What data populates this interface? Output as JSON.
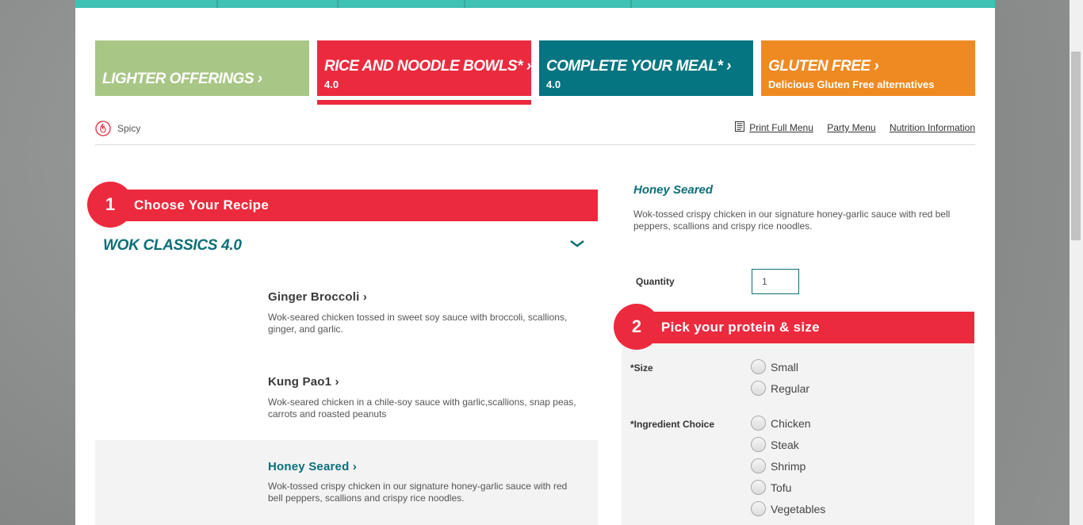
{
  "categories": [
    {
      "title": "LIGHTER OFFERINGS",
      "subtitle": ""
    },
    {
      "title": "RICE AND NOODLE BOWLS*",
      "subtitle": "4.0"
    },
    {
      "title": "COMPLETE YOUR MEAL*",
      "subtitle": "4.0"
    },
    {
      "title": "GLUTEN FREE",
      "subtitle": "Delicious Gluten Free alternatives"
    }
  ],
  "chevron": "›",
  "legend": {
    "spicy_label": "Spicy",
    "spicy_icon": "flame-icon"
  },
  "links": {
    "print": "Print Full Menu",
    "party": "Party Menu",
    "nutrition": "Nutrition Information"
  },
  "step1": {
    "number": "1",
    "label": "Choose Your Recipe"
  },
  "section": {
    "title": "WOK CLASSICS 4.0"
  },
  "recipes": [
    {
      "name": "Ginger Broccoli",
      "desc": "Wok-seared chicken tossed in sweet soy sauce with broccoli, scallions, ginger, and garlic."
    },
    {
      "name": "Kung Pao1",
      "desc": "Wok-seared chicken in a chile-soy sauce with garlic,scallions, snap peas, carrots and roasted peanuts"
    },
    {
      "name": "Honey Seared",
      "desc": "Wok-tossed crispy chicken in our signature honey-garlic sauce with red bell peppers, scallions and crispy rice noodles."
    }
  ],
  "detail": {
    "title": "Honey Seared",
    "desc": "Wok-tossed crispy chicken in our signature honey-garlic sauce with red bell peppers, scallions and crispy rice noodles.",
    "quantity_label": "Quantity",
    "quantity_value": "1"
  },
  "step2": {
    "number": "2",
    "label": "Pick your protein & size"
  },
  "size": {
    "label": "*Size",
    "options": [
      "Small",
      "Regular"
    ]
  },
  "ingredient": {
    "label": "*Ingredient Choice",
    "options": [
      "Chicken",
      "Steak",
      "Shrimp",
      "Tofu",
      "Vegetables"
    ]
  },
  "colors": {
    "teal": "#3fc1b3",
    "red": "#ec2a3e",
    "dark_teal": "#047581",
    "orange": "#ef8a23",
    "green": "#a8c686"
  }
}
